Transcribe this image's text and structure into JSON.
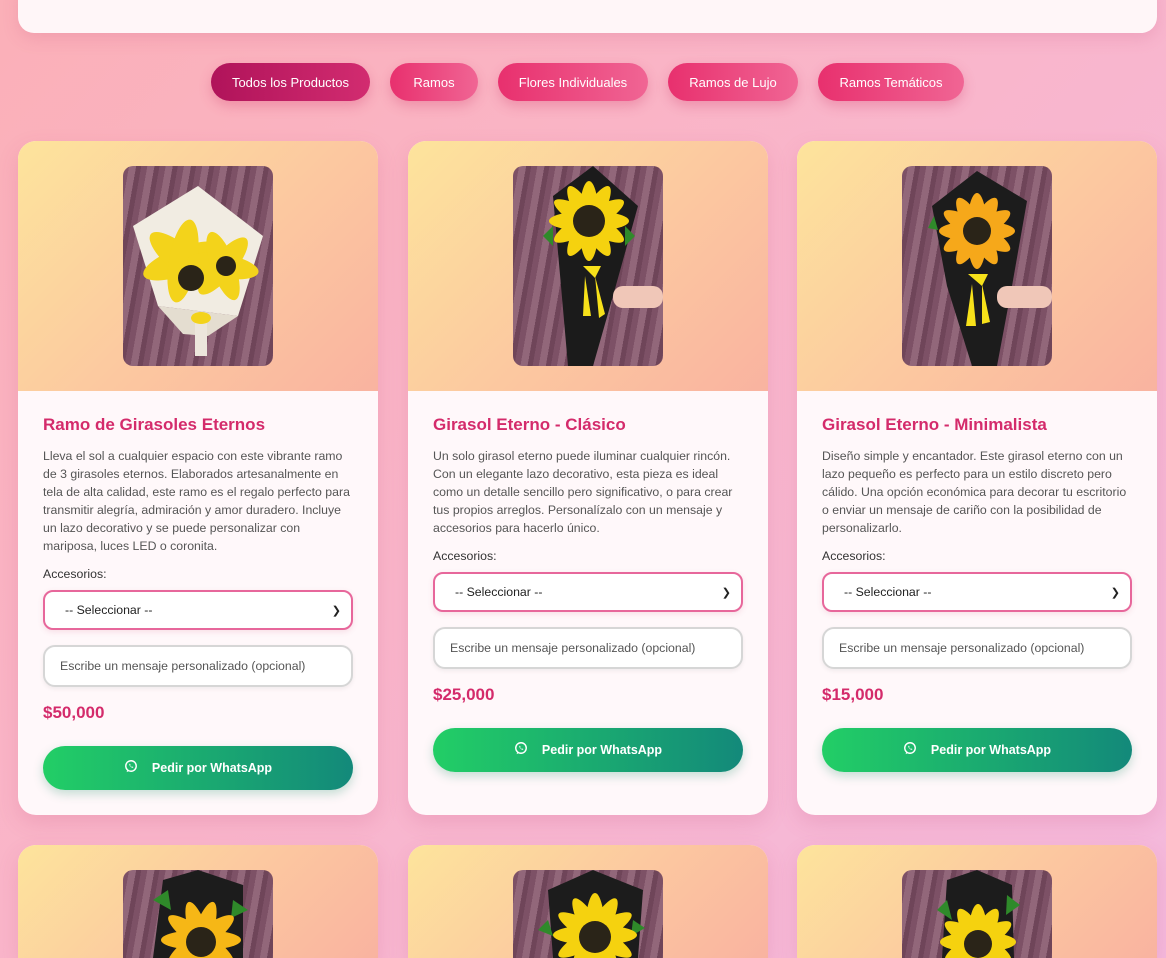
{
  "filters": [
    {
      "label": "Todos los Productos",
      "active": true
    },
    {
      "label": "Ramos"
    },
    {
      "label": "Flores Individuales"
    },
    {
      "label": "Ramos de Lujo"
    },
    {
      "label": "Ramos Temáticos"
    }
  ],
  "products": [
    {
      "title": "Ramo de Girasoles Eternos",
      "description": "Lleva el sol a cualquier espacio con este vibrante ramo de 3 girasoles eternos. Elaborados artesanalmente en tela de alta calidad, este ramo es el regalo perfecto para transmitir alegría, admiración y amor duradero. Incluye un lazo decorativo y se puede personalizar con mariposa, luces LED o coronita.",
      "accessories_label": "Accesorios:",
      "select_value": "-- Seleccionar --",
      "message_placeholder": "Escribe un mensaje personalizado (opcional)",
      "price": "$50,000",
      "button_label": "Pedir por WhatsApp"
    },
    {
      "title": "Girasol Eterno - Clásico",
      "description": "Un solo girasol eterno puede iluminar cualquier rincón. Con un elegante lazo decorativo, esta pieza es ideal como un detalle sencillo pero significativo, o para crear tus propios arreglos. Personalízalo con un mensaje y accesorios para hacerlo único.",
      "accessories_label": "Accesorios:",
      "select_value": "-- Seleccionar --",
      "message_placeholder": "Escribe un mensaje personalizado (opcional)",
      "price": "$25,000",
      "button_label": "Pedir por WhatsApp"
    },
    {
      "title": "Girasol Eterno - Minimalista",
      "description": "Diseño simple y encantador. Este girasol eterno con un lazo pequeño es perfecto para un estilo discreto pero cálido. Una opción económica para decorar tu escritorio o enviar un mensaje de cariño con la posibilidad de personalizarlo.",
      "accessories_label": "Accesorios:",
      "select_value": "-- Seleccionar --",
      "message_placeholder": "Escribe un mensaje personalizado (opcional)",
      "price": "$15,000",
      "button_label": "Pedir por WhatsApp"
    }
  ],
  "colors": {
    "accent": "#d42b6b",
    "filter_button": "#e8306e",
    "whatsapp_green": "#22ce66"
  }
}
